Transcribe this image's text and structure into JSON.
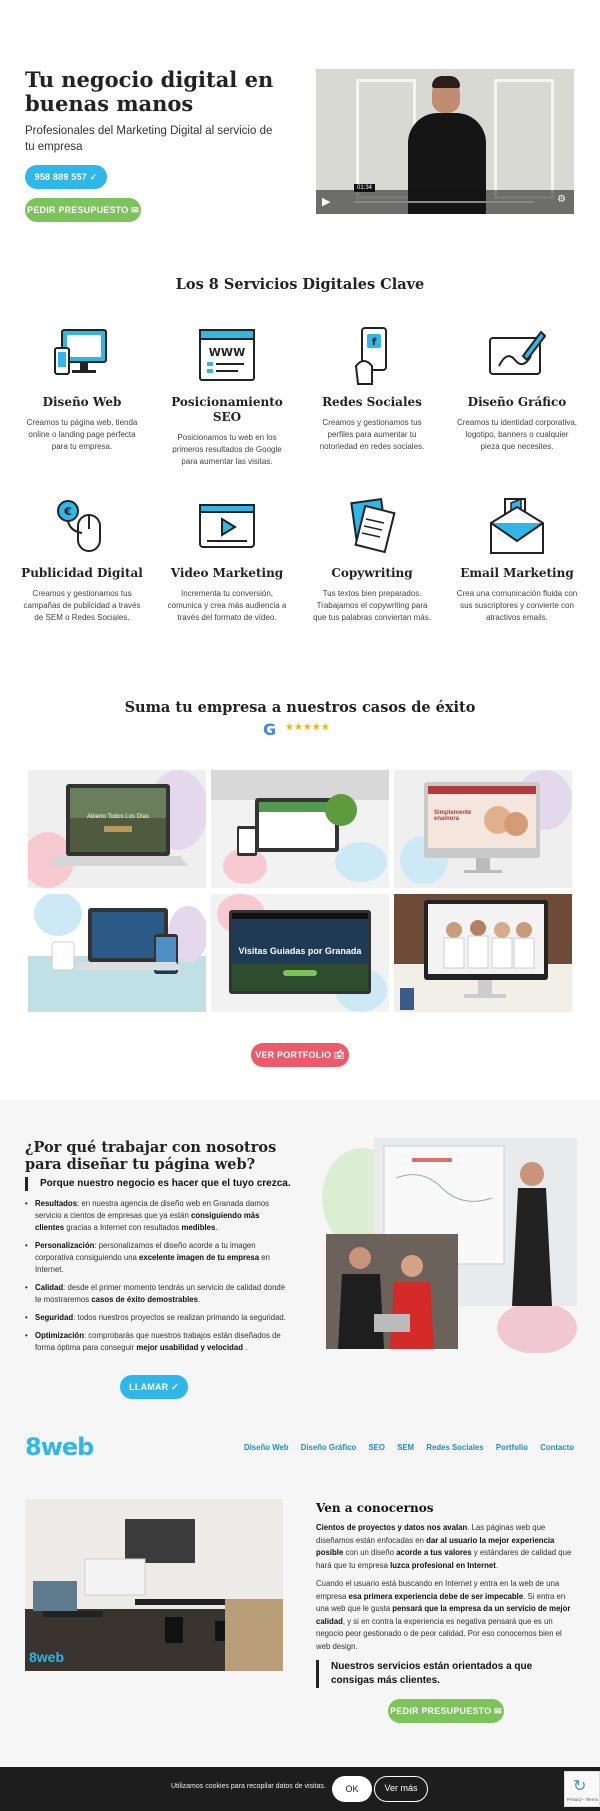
{
  "hero": {
    "title": "Tu negocio digital en buenas manos",
    "subtitle": "Profesionales del Marketing Digital al servicio de tu empresa",
    "phone_label": "958 889 557 ✓",
    "quote_label": "PEDIR PRESUPUESTO ✉"
  },
  "video": {
    "time": "01:34",
    "play_icon": "play-icon",
    "settings_icon": "gear-icon"
  },
  "services": {
    "title": "Los 8 Servicios Digitales Clave",
    "items": [
      {
        "name": "Diseño Web",
        "desc": "Creamos tu página web, tienda online o landing page perfecta para tu empresa.",
        "icon": "devices-icon"
      },
      {
        "name": "Posicionamiento SEO",
        "desc": "Posicionamos tu web en los primeros resultados de Google para aumentar las visitas.",
        "icon": "browser-www-icon"
      },
      {
        "name": "Redes Sociales",
        "desc": "Creamos y gestionamos tus perfiles para aumentar tu notoriedad en redes sociales.",
        "icon": "phone-hand-icon"
      },
      {
        "name": "Diseño Gráfico",
        "desc": "Creamos tu identidad corporativa, logotipo, banners o cualquier pieza que necesites.",
        "icon": "design-tablet-icon"
      },
      {
        "name": "Publicidad Digital",
        "desc": "Creamos y gestionamos tus campañas de publicidad a través de SEM o Redes Sociales.",
        "icon": "euro-mouse-icon"
      },
      {
        "name": "Video Marketing",
        "desc": "Incrementa tu conversión, comunica y crea más audiencia a través del formato de vídeo.",
        "icon": "video-player-icon"
      },
      {
        "name": "Copywriting",
        "desc": "Tus textos bien preparados. Trabajamos el copywriting para que tus palabras conviertan más.",
        "icon": "documents-icon"
      },
      {
        "name": "Email Marketing",
        "desc": "Crea una comunicación fluida con sus suscriptores y convierte con atractivos emails.",
        "icon": "email-megaphone-icon"
      }
    ]
  },
  "portfolio": {
    "title": "Suma tu empresa a nuestros casos de éxito",
    "google_letter": "G",
    "stars": "★★★★★",
    "button_label": "VER PORTFOLIO 🖆",
    "items": [
      {
        "caption": "Abierto Todos Los Días"
      },
      {
        "caption": ""
      },
      {
        "caption": "Simplemente enamora"
      },
      {
        "caption": ""
      },
      {
        "caption": "Visitas Guiadas por Granada"
      },
      {
        "caption": ""
      }
    ]
  },
  "why": {
    "title": "¿Por qué trabajar con nosotros para diseñar tu página web?",
    "quote": "Porque nuestro negocio es hacer que el tuyo crezca.",
    "call_label": "LLAMAR ✓"
  },
  "nav": {
    "logo": "8web",
    "items": [
      "Diseño Web",
      "Diseño Gráfico",
      "SEO",
      "SEM",
      "Redes Sociales",
      "Portfolio",
      "Contacto"
    ]
  },
  "about": {
    "title": "Ven a conocernos",
    "office_logo": "8web",
    "quote": "Nuestros servicios están orientados a que consigas más clientes.",
    "button_label": "PEDIR PRESUPUESTO ✉"
  },
  "cookie": {
    "text": "Utilizamos cookies para recopilar datos de visitas.",
    "ok_label": "OK",
    "more_label": "Ver más"
  },
  "recaptcha": {
    "label": "Privacy - Terms"
  },
  "colors": {
    "blue": "#2fb7e8",
    "green": "#7cc35b",
    "red": "#ef5a6a",
    "dark": "#222222"
  }
}
